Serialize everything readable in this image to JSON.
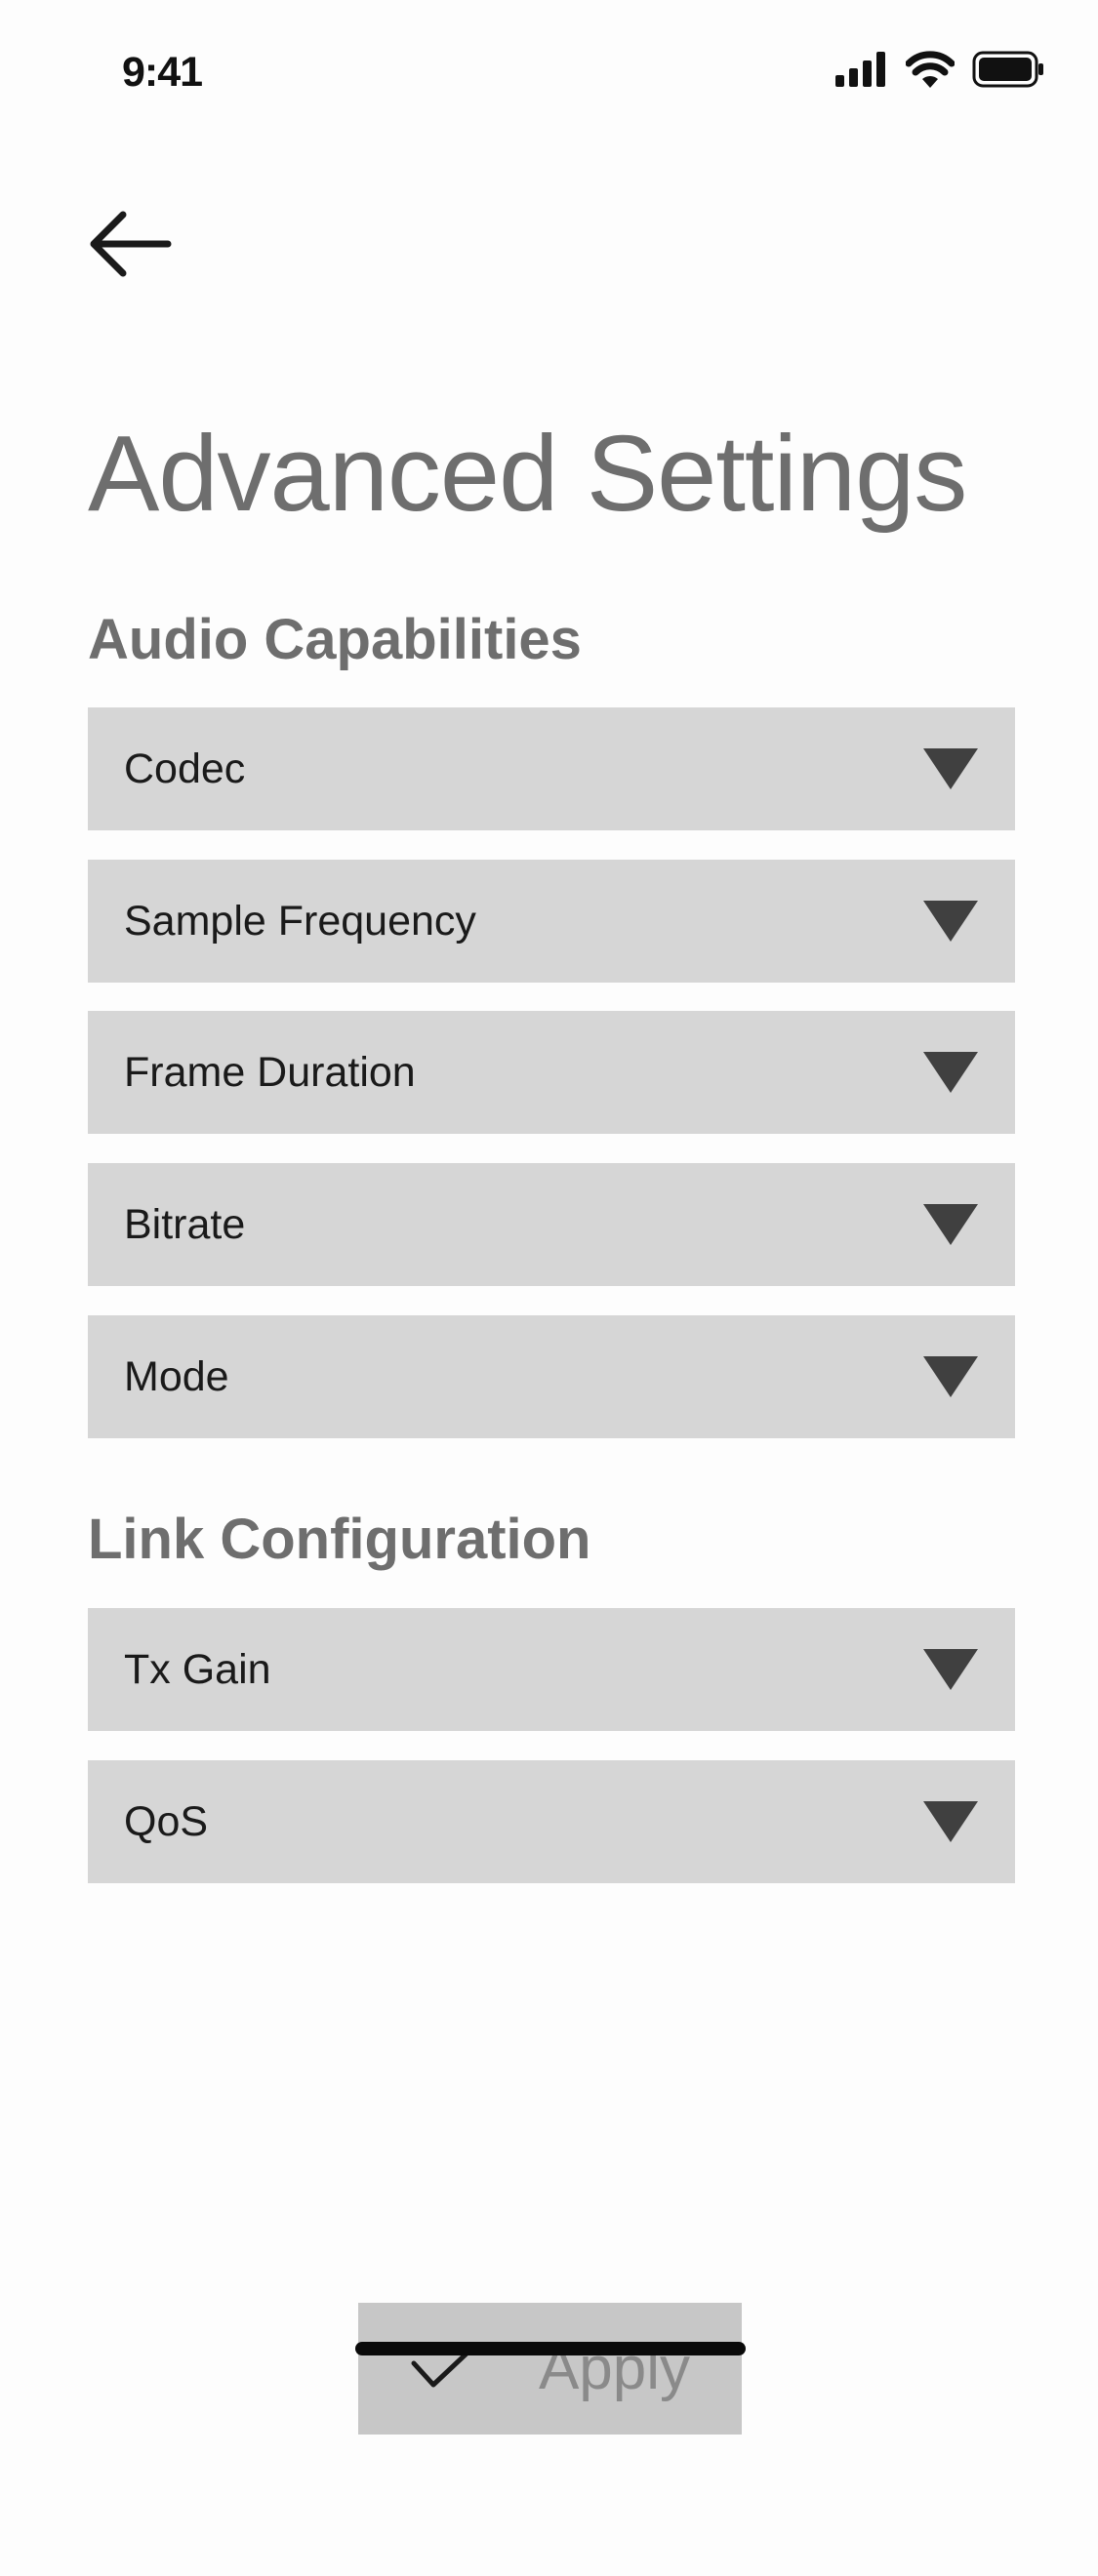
{
  "status_bar": {
    "time": "9:41",
    "icons": [
      "cellular-signal-icon",
      "wifi-icon",
      "battery-icon"
    ]
  },
  "header": {
    "back_icon": "arrow-left-icon",
    "title": "Advanced Settings"
  },
  "sections": [
    {
      "title": "Audio Capabilities",
      "dropdowns": [
        {
          "label": "Codec"
        },
        {
          "label": "Sample Frequency"
        },
        {
          "label": "Frame Duration"
        },
        {
          "label": "Bitrate"
        },
        {
          "label": "Mode"
        }
      ]
    },
    {
      "title": "Link Configuration",
      "dropdowns": [
        {
          "label": "Tx Gain"
        },
        {
          "label": "QoS"
        }
      ]
    }
  ],
  "apply_button": {
    "label": "Apply",
    "icon": "checkmark-icon"
  },
  "colors": {
    "background": "#fdfdfd",
    "dropdown_bg": "#d6d6d6",
    "heading_gray": "#6e6e6e",
    "arrow_dark": "#404040",
    "apply_bg": "#c7c7c7"
  }
}
